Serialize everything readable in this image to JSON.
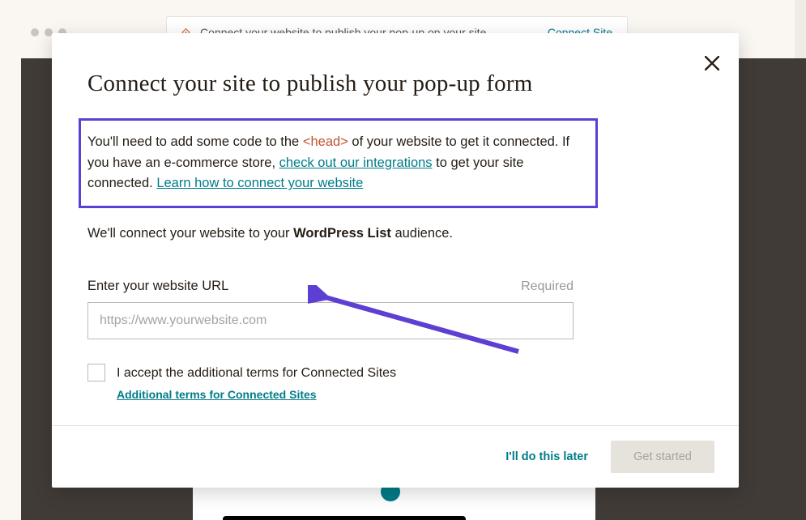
{
  "bg_banner": {
    "text": "Connect your website to publish your pop-up on your site",
    "link": "Connect Site"
  },
  "modal": {
    "title": "Connect your site to publish your pop-up form",
    "intro": {
      "part1": "You'll need to add some code to the ",
      "code": "<head>",
      "part2": " of your website to get it connected. If you have an e-commerce store, ",
      "link1": "check out our integrations",
      "part3": " to get your site connected. ",
      "link2": "Learn how to connect your website"
    },
    "audience": {
      "prefix": "We'll connect your website to your ",
      "list": "WordPress List",
      "suffix": " audience."
    },
    "field": {
      "label": "Enter your website URL",
      "required": "Required",
      "placeholder": "https://www.yourwebsite.com",
      "value": ""
    },
    "terms": {
      "text": "I accept the additional terms for Connected Sites",
      "link": "Additional terms for Connected Sites"
    },
    "footer": {
      "later": "I'll do this later",
      "start": "Get started"
    }
  }
}
